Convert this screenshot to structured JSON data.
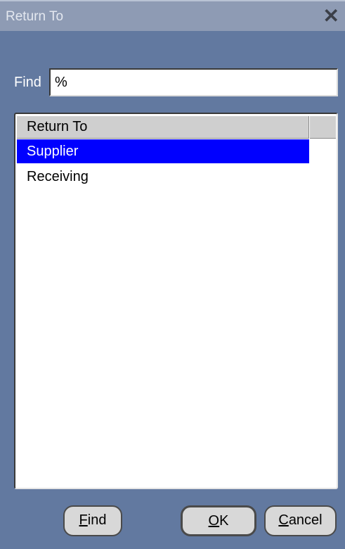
{
  "dialog": {
    "title": "Return To",
    "close_icon": "close-icon"
  },
  "find": {
    "label": "Find",
    "value": "%"
  },
  "list": {
    "column_header": "Return To",
    "items": [
      {
        "label": "Supplier",
        "selected": true
      },
      {
        "label": "Receiving",
        "selected": false
      }
    ]
  },
  "buttons": {
    "find": {
      "mnemonic": "F",
      "rest": "ind"
    },
    "ok": {
      "mnemonic": "O",
      "rest": "K"
    },
    "cancel": {
      "mnemonic": "C",
      "rest": "ancel"
    }
  },
  "colors": {
    "background": "#6279a0",
    "titlebar": "#8e9bb4",
    "selection": "#0000ff"
  }
}
